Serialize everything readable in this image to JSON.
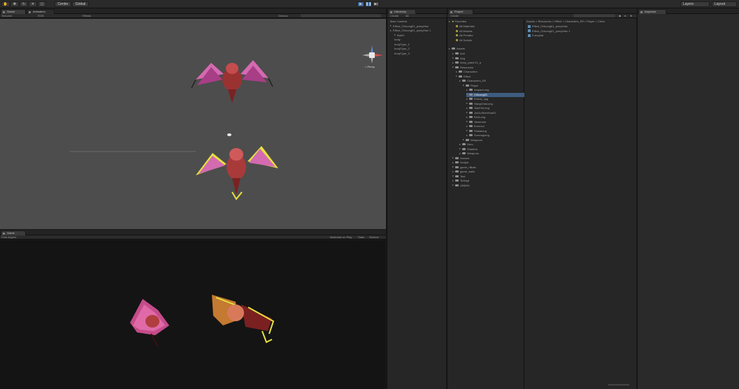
{
  "toolbar": {
    "pivot_label": "Center",
    "space_label": "Global",
    "layers_label": "Layers",
    "layout_label": "Layout"
  },
  "scene": {
    "tab_label": "Scene",
    "tab2_label": "Animation",
    "shading_label": "Textured",
    "mode_label": "RGB",
    "effects_label": "Effects",
    "gizmos_label": "Gizmos",
    "persp_label": "< Persp"
  },
  "game": {
    "tab_label": "Game",
    "aspect_label": "Free Aspect",
    "maximize_label": "Maximize on Play",
    "stats_label": "Stats",
    "gizmos_label": "Gizmos"
  },
  "hierarchy": {
    "tab_label": "Hierarchy",
    "create_label": "Create",
    "search_label": "All",
    "items": [
      {
        "label": "Main Camera",
        "indent": 0,
        "fold": false
      },
      {
        "label": "Effect_Chicong01_pompHse",
        "indent": 0,
        "fold": true
      },
      {
        "label": "Effect_Chicong01_pompHse 1",
        "indent": 0,
        "fold": true
      },
      {
        "label": "Bat01",
        "indent": 1,
        "fold": true
      },
      {
        "label": "body",
        "indent": 1,
        "fold": false
      },
      {
        "label": "bodyType_1",
        "indent": 1,
        "fold": false
      },
      {
        "label": "bodyType_2",
        "indent": 1,
        "fold": false
      },
      {
        "label": "bodyType_3",
        "indent": 1,
        "fold": false
      }
    ]
  },
  "project": {
    "tab_label": "Project",
    "create_label": "Create",
    "favorites_label": "Favorites",
    "favorites": [
      "All Materials",
      "All Models",
      "All Prefabs",
      "All Scripts"
    ],
    "assets_label": "Assets",
    "tree": [
      {
        "label": "Aoe",
        "indent": 1
      },
      {
        "label": "Ang",
        "indent": 1
      },
      {
        "label": "Anny_plant 01_a",
        "indent": 1
      },
      {
        "label": "Resources",
        "indent": 1
      },
      {
        "label": "Characters",
        "indent": 2
      },
      {
        "label": "Effect",
        "indent": 2
      },
      {
        "label": "Characters_Eff",
        "indent": 3
      },
      {
        "label": "Player",
        "indent": 4
      },
      {
        "label": "AnqiaoLong",
        "indent": 5
      },
      {
        "label": "Chicong01",
        "indent": 5,
        "selected": true
      },
      {
        "label": "Emeal_opg",
        "indent": 5
      },
      {
        "label": "HangChiaLong",
        "indent": 5
      },
      {
        "label": "JianFeiLong",
        "indent": 5
      },
      {
        "label": "JiuGuShenHua01",
        "indent": 5
      },
      {
        "label": "KiruLong",
        "indent": 5
      },
      {
        "label": "Jiesenme",
        "indent": 5
      },
      {
        "label": "Koreno1",
        "indent": 5
      },
      {
        "label": "Shalalong",
        "indent": 5
      },
      {
        "label": "Surrenglong",
        "indent": 5
      },
      {
        "label": "Weapons",
        "indent": 4
      },
      {
        "label": "Hero",
        "indent": 3
      },
      {
        "label": "Shaders",
        "indent": 3
      },
      {
        "label": "Weapons",
        "indent": 3
      },
      {
        "label": "Scenes",
        "indent": 1
      },
      {
        "label": "Scripts",
        "indent": 1
      },
      {
        "label": "game_rtBats",
        "indent": 1
      },
      {
        "label": "game_walls",
        "indent": 1
      },
      {
        "label": "Test",
        "indent": 1
      },
      {
        "label": "Textagt",
        "indent": 1
      },
      {
        "label": "Util&Ed",
        "indent": 1
      }
    ],
    "breadcrumb": "Assets > Resources > Effect > Characters_Eff > Player > Chico",
    "files": [
      "Effect_Chicong01_pompHse",
      "Effect_Chicong01_pompHse 1",
      "Fuzzybat"
    ]
  },
  "inspector": {
    "tab_label": "Inspector"
  },
  "colors": {
    "accent": "#3e5c80",
    "scene_bg": "#4d4d4d",
    "game_bg": "#141414",
    "panel_bg": "#262626"
  }
}
